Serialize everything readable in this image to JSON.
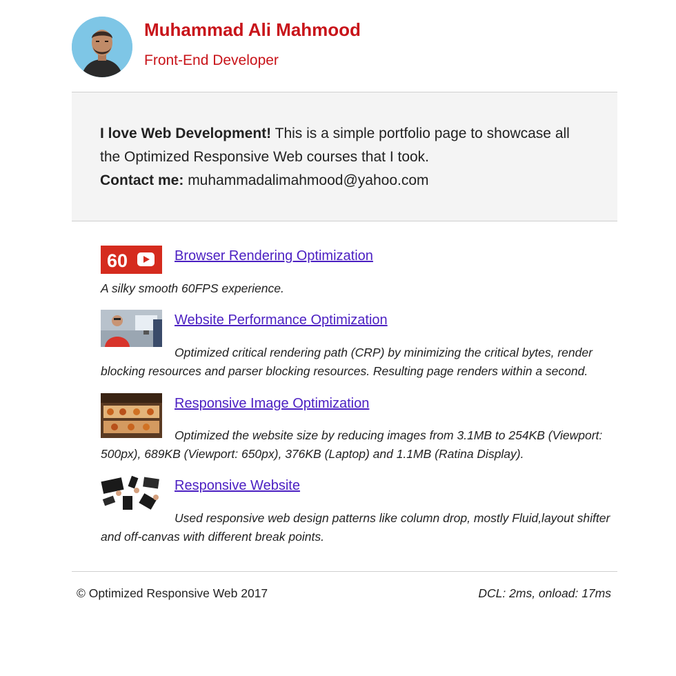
{
  "header": {
    "name": "Muhammad Ali Mahmood",
    "role": "Front-End Developer"
  },
  "intro": {
    "lead_bold": "I love Web Development!",
    "lead_rest": " This is a simple portfolio page to showcase all the Optimized Responsive Web courses that I took.",
    "contact_label": "Contact me:",
    "contact_email": " muhammadalimahmood@yahoo.com"
  },
  "courses": [
    {
      "title": "Browser Rendering Optimization",
      "description": "A silky smooth 60FPS experience.",
      "thumb_text": "60",
      "thumb_color": "#d52b1e"
    },
    {
      "title": "Website Performance Optimization",
      "description": "Optimized critical rendering path (CRP) by minimizing the critical bytes, render blocking resources and parser blocking resources. Resulting page renders within a second."
    },
    {
      "title": "Responsive Image Optimization",
      "description": "Optimized the website size by reducing images from 3.1MB to 254KB (Viewport: 500px), 689KB (Viewport: 650px), 376KB (Laptop) and 1.1MB (Ratina Display)."
    },
    {
      "title": "Responsive Website",
      "description": "Used responsive web design patterns like column drop, mostly Fluid,layout shifter and off-canvas with different break points."
    }
  ],
  "footer": {
    "copyright": "© Optimized Responsive Web 2017",
    "timing": "DCL: 2ms, onload: 17ms"
  },
  "colors": {
    "accent": "#c8141a",
    "link": "#4b1fc2",
    "intro_bg": "#f4f4f4"
  }
}
